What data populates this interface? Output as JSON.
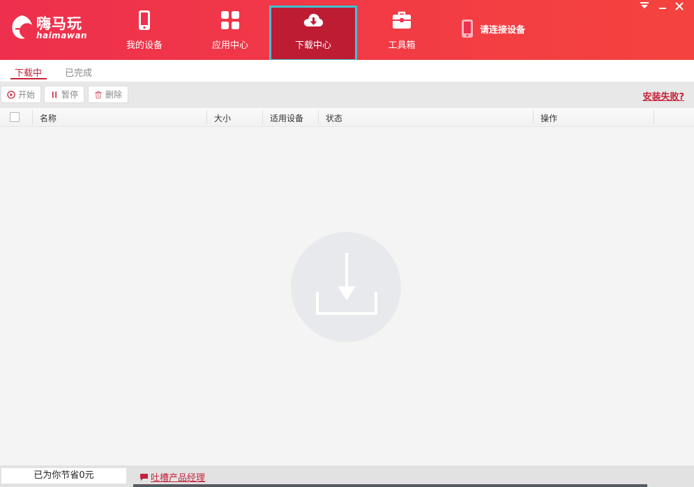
{
  "app": {
    "logo_text": "嗨马玩",
    "logo_sub": "haimawan"
  },
  "nav": {
    "items": [
      {
        "label": "我的设备",
        "icon": "phone-icon"
      },
      {
        "label": "应用中心",
        "icon": "apps-grid-icon"
      },
      {
        "label": "下载中心",
        "icon": "cloud-download-icon",
        "active": true
      },
      {
        "label": "工具箱",
        "icon": "toolbox-icon"
      }
    ],
    "connect_label": "请连接设备"
  },
  "window_controls": {
    "menu": "▼",
    "minimize": "—",
    "close": "✕"
  },
  "subtabs": [
    {
      "label": "下载中心_下载中",
      "text": "下载中",
      "active": true
    },
    {
      "text": "已完成",
      "active": false
    }
  ],
  "toolbar": {
    "start_label": "开始",
    "pause_label": "暂停",
    "delete_label": "删除",
    "install_fail_link": "安装失败?"
  },
  "table": {
    "columns": [
      "名称",
      "大小",
      "适用设备",
      "状态",
      "操作"
    ],
    "rows": []
  },
  "empty_state": {
    "icon": "download-tray-icon"
  },
  "footer": {
    "saved_text": "已为你节省0元",
    "feedback_text": "吐槽产品经理"
  },
  "colors": {
    "brand_red": "#ee2f4d",
    "active_tab_bg": "#bd1c33",
    "active_tab_border": "#3fc2d0",
    "accent_text": "#c4233a"
  }
}
